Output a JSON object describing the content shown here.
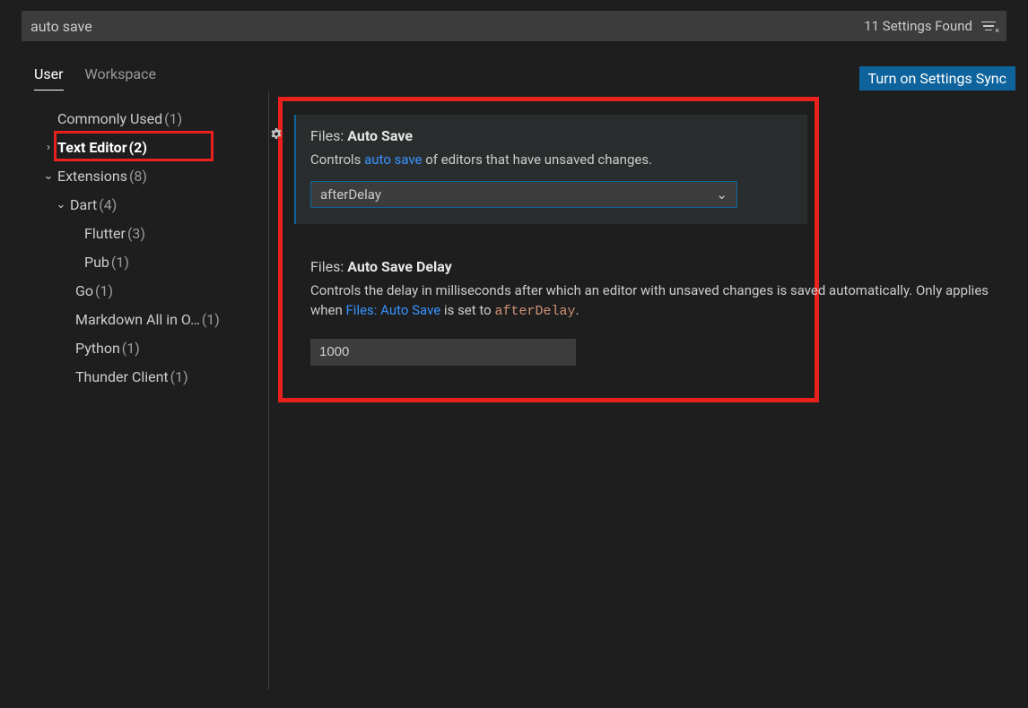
{
  "search": {
    "value": "auto save",
    "results_text": "11 Settings Found"
  },
  "tabs": {
    "user": "User",
    "workspace": "Workspace"
  },
  "sync_button": "Turn on Settings Sync",
  "sidebar": {
    "items": [
      {
        "label": "Commonly Used",
        "count": "(1)"
      },
      {
        "label": "Text Editor",
        "count": "(2)"
      },
      {
        "label": "Extensions",
        "count": "(8)"
      },
      {
        "label": "Dart",
        "count": "(4)"
      },
      {
        "label": "Flutter",
        "count": "(3)"
      },
      {
        "label": "Pub",
        "count": "(1)"
      },
      {
        "label": "Go",
        "count": "(1)"
      },
      {
        "label": "Markdown All in O…",
        "count": "(1)"
      },
      {
        "label": "Python",
        "count": "(1)"
      },
      {
        "label": "Thunder Client",
        "count": "(1)"
      }
    ]
  },
  "settings": {
    "autoSave": {
      "prefix": "Files: ",
      "name": "Auto Save",
      "desc_before": "Controls ",
      "desc_link": "auto save",
      "desc_after": " of editors that have unsaved changes.",
      "value": "afterDelay"
    },
    "autoSaveDelay": {
      "prefix": "Files: ",
      "name": "Auto Save Delay",
      "desc_1": "Controls the delay in milliseconds after which an editor with unsaved changes is saved automatically. Only applies when ",
      "desc_link": "Files: Auto Save",
      "desc_2": " is set to ",
      "desc_code": "afterDelay",
      "desc_3": ".",
      "value": "1000"
    }
  }
}
